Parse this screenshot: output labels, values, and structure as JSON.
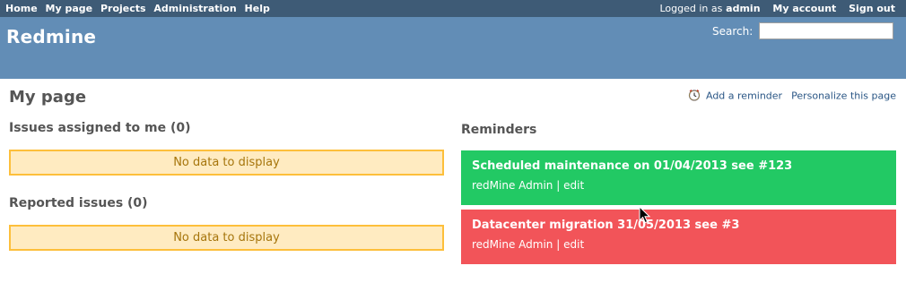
{
  "top_menu": {
    "items": [
      "Home",
      "My page",
      "Projects",
      "Administration",
      "Help"
    ],
    "logged_in_prefix": "Logged in as",
    "user": "admin",
    "my_account": "My account",
    "sign_out": "Sign out"
  },
  "header": {
    "title": "Redmine",
    "search_label": "Search:",
    "search_value": ""
  },
  "page": {
    "title": "My page",
    "add_reminder": "Add a reminder",
    "personalize": "Personalize this page"
  },
  "blocks": {
    "assigned": {
      "title": "Issues assigned to me (0)",
      "empty": "No data to display"
    },
    "reported": {
      "title": "Reported issues (0)",
      "empty": "No data to display"
    }
  },
  "reminders": {
    "title": "Reminders",
    "items": [
      {
        "subject": "Scheduled maintenance on 01/04/2013 see #123",
        "author": "redMine Admin",
        "separator": "|",
        "edit": "edit",
        "color": "#22c964"
      },
      {
        "subject": "Datacenter migration 31/05/2013 see #3",
        "author": "redMine Admin",
        "separator": "|",
        "edit": "edit",
        "color": "#f25459"
      }
    ]
  },
  "colors": {
    "top_menu_bg": "#3e5b76",
    "header_bg": "#628db6",
    "nodata_bg": "#ffebc1",
    "nodata_border": "#fdbf3b"
  }
}
